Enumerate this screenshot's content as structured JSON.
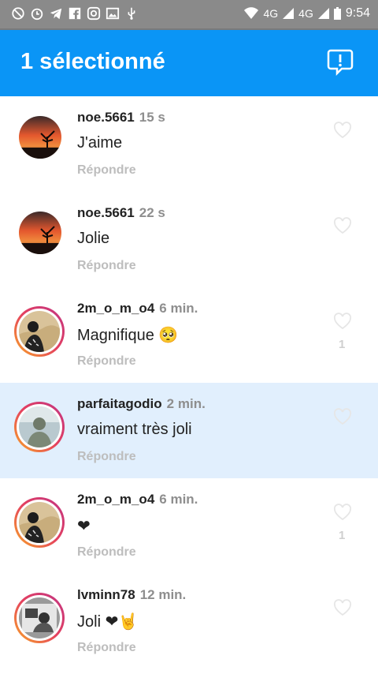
{
  "status_bar": {
    "icons_left": [
      "no-disturb-icon",
      "alarm-icon",
      "telegram-icon",
      "facebook-icon",
      "instagram-icon",
      "image-icon",
      "usb-icon"
    ],
    "network_1": "4G",
    "network_2": "4G",
    "time": "9:54"
  },
  "header": {
    "title": "1 sélectionné",
    "action_icon": "report-icon"
  },
  "comments": [
    {
      "username": "noe.5661",
      "time": "15 s",
      "text": "J'aime",
      "reply": "Répondre",
      "likes": "",
      "selected": false,
      "ring": false,
      "avatar": "sunset"
    },
    {
      "username": "noe.5661",
      "time": "22 s",
      "text": "Jolie",
      "reply": "Répondre",
      "likes": "",
      "selected": false,
      "ring": false,
      "avatar": "sunset"
    },
    {
      "username": "2m_o_m_o4",
      "time": "6 min.",
      "text": "Magnifique 🥺",
      "reply": "Répondre",
      "likes": "1",
      "selected": false,
      "ring": true,
      "avatar": "sand"
    },
    {
      "username": "parfaitagodio",
      "time": "2 min.",
      "text": "vraiment très joli",
      "reply": "Répondre",
      "likes": "",
      "selected": true,
      "ring": true,
      "avatar": "person"
    },
    {
      "username": "2m_o_m_o4",
      "time": "6 min.",
      "text": "❤",
      "reply": "Répondre",
      "likes": "1",
      "selected": false,
      "ring": true,
      "avatar": "sand"
    },
    {
      "username": "lvminn78",
      "time": "12 min.",
      "text": "Joli ❤🤘",
      "reply": "Répondre",
      "likes": "",
      "selected": false,
      "ring": true,
      "avatar": "bw"
    }
  ],
  "colors": {
    "accent": "#0a95f6",
    "selected_row": "#e1effd"
  }
}
